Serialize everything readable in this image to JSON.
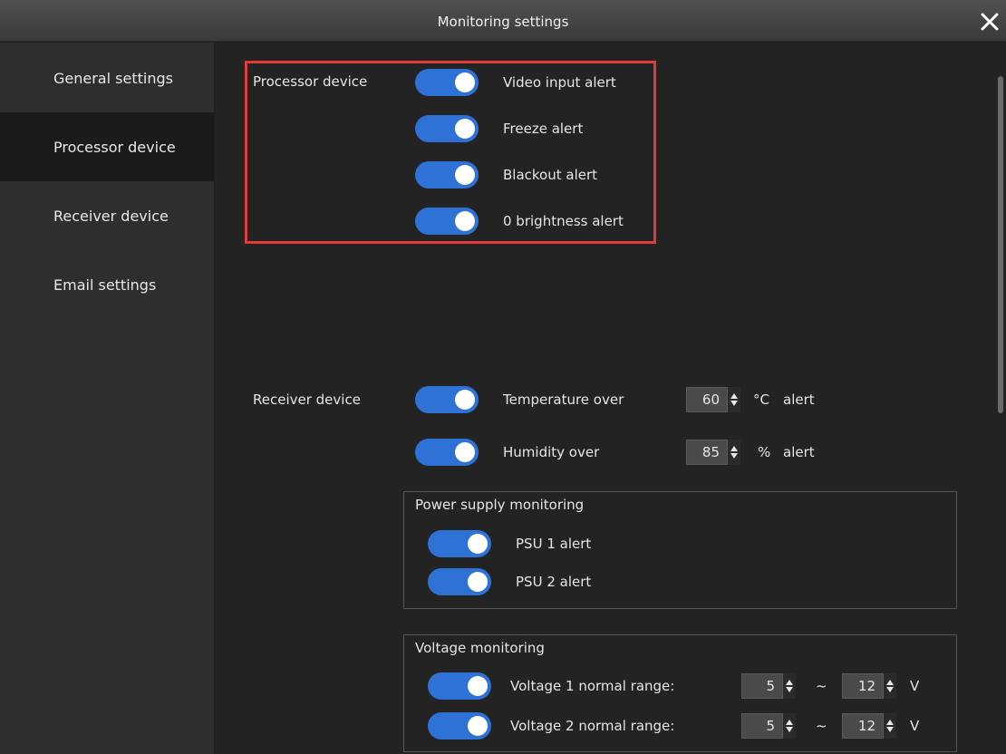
{
  "window": {
    "title": "Monitoring settings",
    "close_icon": "close-icon"
  },
  "sidebar": {
    "items": [
      {
        "label": "General settings",
        "active": false
      },
      {
        "label": "Processor device",
        "active": true
      },
      {
        "label": "Receiver device",
        "active": false
      },
      {
        "label": "Email settings",
        "active": false
      }
    ]
  },
  "processor": {
    "section_label": "Processor device",
    "alerts": [
      {
        "label": "Video input alert",
        "enabled": true
      },
      {
        "label": "Freeze alert",
        "enabled": true
      },
      {
        "label": "Blackout alert",
        "enabled": true
      },
      {
        "label": "0 brightness alert",
        "enabled": true
      }
    ]
  },
  "receiver": {
    "section_label": "Receiver device",
    "temperature": {
      "label": "Temperature over",
      "value": "60",
      "unit": "°C",
      "suffix": "alert",
      "enabled": true
    },
    "humidity": {
      "label": "Humidity over",
      "value": "85",
      "unit": "%",
      "suffix": "alert",
      "enabled": true
    }
  },
  "power_supply": {
    "title": "Power supply monitoring",
    "items": [
      {
        "label": "PSU 1 alert",
        "enabled": true
      },
      {
        "label": "PSU 2 alert",
        "enabled": true
      }
    ]
  },
  "voltage": {
    "title": "Voltage monitoring",
    "items": [
      {
        "label": "Voltage 1 normal range:",
        "min": "5",
        "max": "12",
        "separator": "~",
        "unit": "V",
        "enabled": true
      },
      {
        "label": "Voltage 2 normal range:",
        "min": "5",
        "max": "12",
        "separator": "~",
        "unit": "V",
        "enabled": true
      }
    ]
  },
  "colors": {
    "toggle_on": "#2f72d6",
    "highlight_border": "#e33b3b"
  }
}
